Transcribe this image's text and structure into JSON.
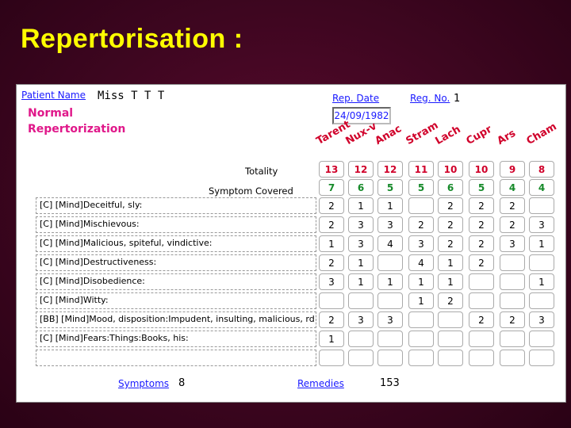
{
  "title": "Repertorisation :",
  "patient": {
    "label": "Patient Name",
    "value": "Miss  T T T"
  },
  "heading": {
    "line1": "Normal",
    "line2": "Repertorization"
  },
  "rep_date": {
    "label": "Rep. Date",
    "value": "24/09/1982"
  },
  "reg_no": {
    "label": "Reg. No.",
    "value": "1"
  },
  "remedies": [
    {
      "name": "Tarent",
      "color": "#d0002a"
    },
    {
      "name": "Nux-v",
      "color": "#d0002a"
    },
    {
      "name": "Anac",
      "color": "#d0002a"
    },
    {
      "name": "Stram",
      "color": "#d0002a"
    },
    {
      "name": "Lach",
      "color": "#d0002a"
    },
    {
      "name": "Cupr",
      "color": "#d0002a"
    },
    {
      "name": "Ars",
      "color": "#d0002a"
    },
    {
      "name": "Cham",
      "color": "#d0002a"
    }
  ],
  "totality": {
    "label": "Totality",
    "values": [
      "13",
      "12",
      "12",
      "11",
      "10",
      "10",
      "9",
      "8"
    ]
  },
  "covered": {
    "label": "Symptom Covered",
    "values": [
      "7",
      "6",
      "5",
      "5",
      "6",
      "5",
      "4",
      "4"
    ]
  },
  "symptoms": [
    {
      "text": "[C] [Mind]Deceitful, sly:",
      "values": [
        "2",
        "1",
        "1",
        "",
        "2",
        "2",
        "2",
        ""
      ]
    },
    {
      "text": "[C] [Mind]Mischievous:",
      "values": [
        "2",
        "3",
        "3",
        "2",
        "2",
        "2",
        "2",
        "3"
      ]
    },
    {
      "text": "[C] [Mind]Malicious, spiteful, vindictive:",
      "values": [
        "1",
        "3",
        "4",
        "3",
        "2",
        "2",
        "3",
        "1"
      ]
    },
    {
      "text": "[C] [Mind]Destructiveness:",
      "values": [
        "2",
        "1",
        "",
        "4",
        "1",
        "2",
        "",
        ""
      ]
    },
    {
      "text": "[C] [Mind]Disobedience:",
      "values": [
        "3",
        "1",
        "1",
        "1",
        "1",
        "",
        "",
        "1"
      ]
    },
    {
      "text": "[C] [Mind]Witty:",
      "values": [
        "",
        "",
        "",
        "1",
        "2",
        "",
        "",
        ""
      ]
    },
    {
      "text": "[BB] [Mind]Mood, disposition:Impudent, insulting, malicious, rd",
      "values": [
        "2",
        "3",
        "3",
        "",
        "",
        "2",
        "2",
        "3"
      ]
    },
    {
      "text": "[C] [Mind]Fears:Things:Books, his:",
      "values": [
        "1",
        "",
        "",
        "",
        "",
        "",
        "",
        ""
      ]
    },
    {
      "text": "",
      "values": [
        "",
        "",
        "",
        "",
        "",
        "",
        "",
        ""
      ]
    }
  ],
  "footer": {
    "symptoms_label": "Symptoms",
    "symptoms_value": "8",
    "remedies_label": "Remedies",
    "remedies_value": "153"
  }
}
